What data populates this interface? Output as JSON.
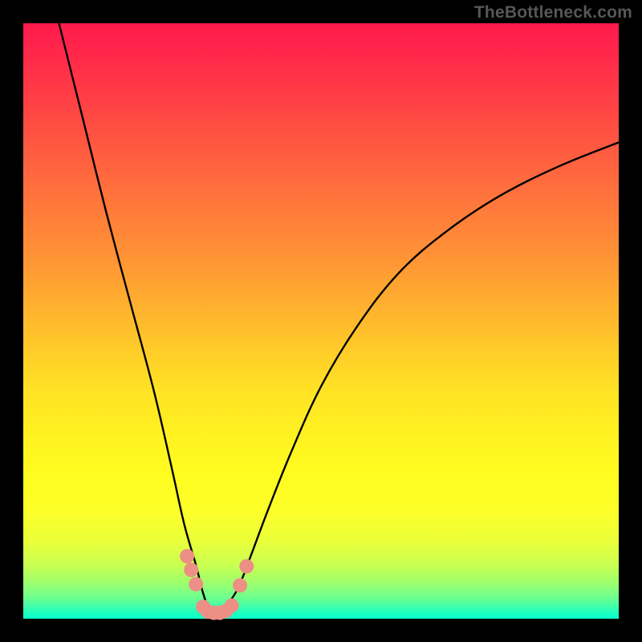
{
  "attribution": "TheBottleneck.com",
  "chart_data": {
    "type": "line",
    "title": "",
    "xlabel": "",
    "ylabel": "",
    "xlim": [
      0,
      100
    ],
    "ylim": [
      0,
      100
    ],
    "series": [
      {
        "name": "bottleneck-curve",
        "x": [
          6,
          10,
          14,
          18,
          22,
          25,
          27,
          29,
          30,
          31,
          32,
          33,
          34,
          36,
          38,
          41,
          45,
          50,
          56,
          63,
          71,
          80,
          90,
          100
        ],
        "values": [
          100,
          84,
          68,
          53,
          38,
          25,
          16,
          9,
          5,
          2,
          1,
          1,
          2,
          5,
          10,
          18,
          28,
          39,
          49,
          58,
          65,
          71,
          76,
          80
        ]
      }
    ],
    "markers": {
      "name": "highlight-dots",
      "color": "#ec8f85",
      "x": [
        27.5,
        28.2,
        29.0,
        30.2,
        31.0,
        32.0,
        33.0,
        34.0,
        35.0,
        36.4,
        37.5
      ],
      "values": [
        10.5,
        8.2,
        5.8,
        2.0,
        1.2,
        1.0,
        1.0,
        1.3,
        2.2,
        5.6,
        8.8
      ]
    }
  }
}
